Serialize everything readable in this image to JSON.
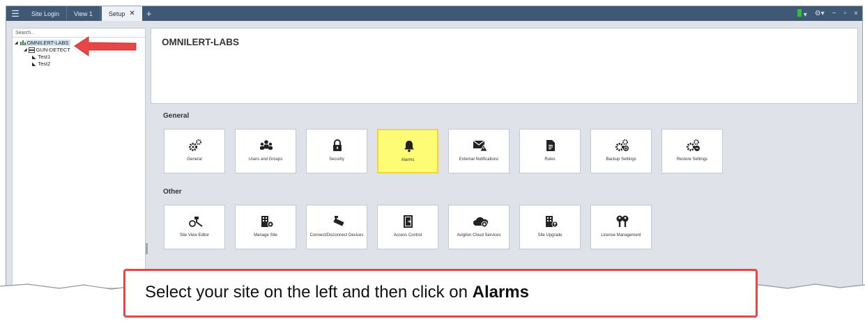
{
  "titlebar": {
    "tabs": [
      {
        "label": "Site Login"
      },
      {
        "label": "View 1"
      },
      {
        "label": "Setup",
        "close": "✕"
      }
    ],
    "add_tab": "+",
    "window_controls": {
      "minimize": "−",
      "maximize": "▫",
      "close": "×"
    }
  },
  "sidebar": {
    "search_placeholder": "Search...",
    "tree": [
      {
        "label": "OMNILERT-LABS",
        "selected": true
      },
      {
        "label": "GUN-DETECT"
      },
      {
        "label": "Test1"
      },
      {
        "label": "Test2"
      }
    ]
  },
  "main": {
    "site_title": "OMNILERT-LABS",
    "sections": [
      {
        "title": "General",
        "tiles": [
          {
            "label": "General",
            "icon": "gears-icon"
          },
          {
            "label": "Users and Groups",
            "icon": "users-icon"
          },
          {
            "label": "Security",
            "icon": "lock-icon"
          },
          {
            "label": "Alarms",
            "icon": "bell-icon",
            "highlighted": true
          },
          {
            "label": "External Notifications",
            "icon": "envelope-warning-icon"
          },
          {
            "label": "Rules",
            "icon": "document-icon"
          },
          {
            "label": "Backup Settings",
            "icon": "gears-backup-icon"
          },
          {
            "label": "Restore Settings",
            "icon": "gears-restore-icon"
          }
        ]
      },
      {
        "title": "Other",
        "tiles": [
          {
            "label": "Site View Editor",
            "icon": "camera-view-icon"
          },
          {
            "label": "Manage Site",
            "icon": "building-gear-icon"
          },
          {
            "label": "Connect/Disconnect Devices",
            "icon": "camera-icon"
          },
          {
            "label": "Access Control",
            "icon": "door-icon"
          },
          {
            "label": "Avigilon Cloud Services",
            "icon": "cloud-icon"
          },
          {
            "label": "Site Upgrade",
            "icon": "building-upgrade-icon"
          },
          {
            "label": "License Management",
            "icon": "keys-icon"
          }
        ]
      }
    ]
  },
  "callout": {
    "text": "Select your site on the left and then click on ",
    "emphasis": "Alarms"
  },
  "colors": {
    "titlebar": "#3f5975",
    "highlight": "#fdfc74",
    "callout_border": "#e24848",
    "arrow": "#e84545"
  }
}
